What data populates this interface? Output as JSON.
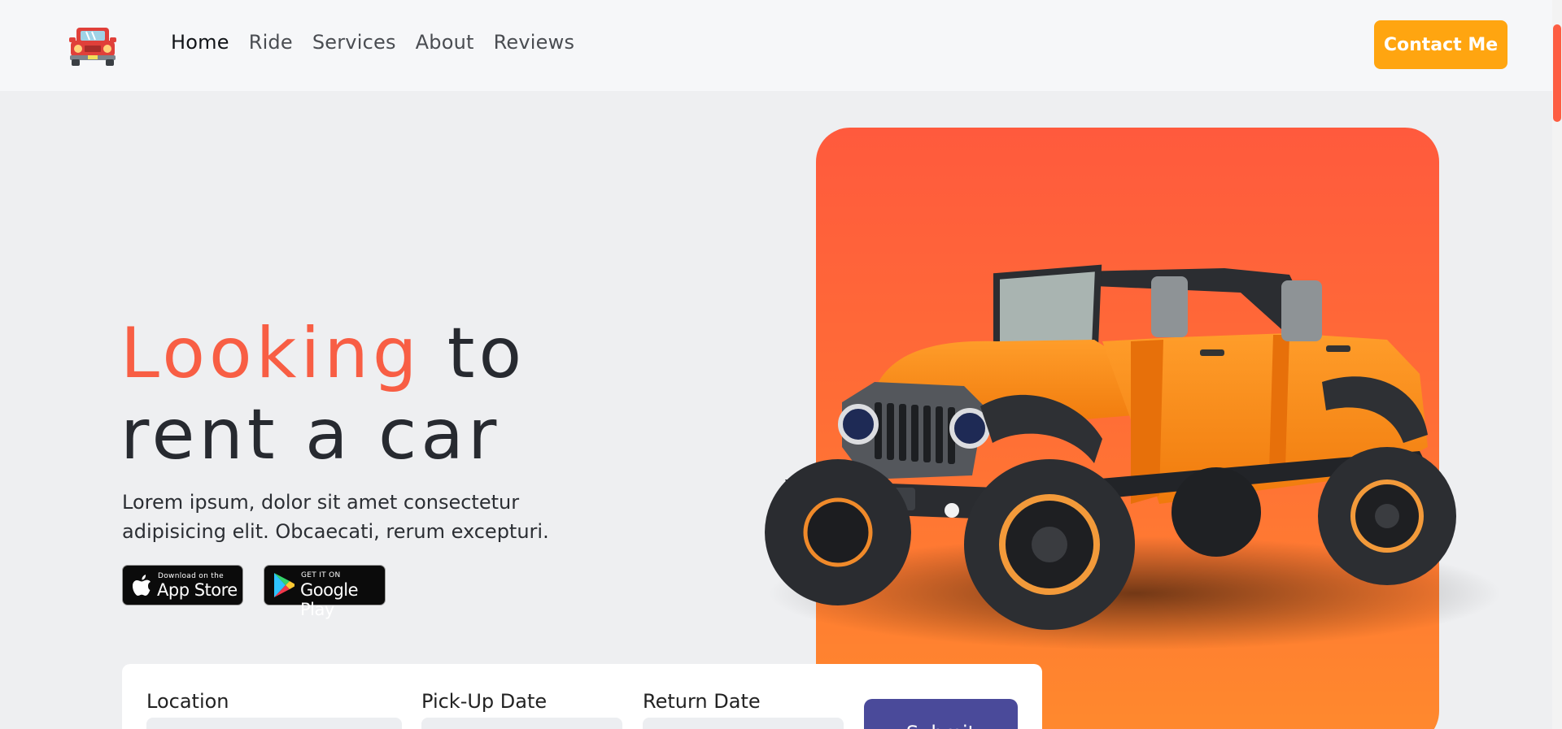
{
  "nav": {
    "logo": "jeep-logo-icon",
    "links": [
      "Home",
      "Ride",
      "Services",
      "About",
      "Reviews"
    ],
    "active": "Home",
    "contact_label": "Contact Me"
  },
  "hero": {
    "title_accent": "Looking",
    "title_rest_line1": "to",
    "title_line2": "rent a car",
    "description": "Lorem ipsum, dolor sit amet consectetur adipisicing elit. Obcaecati, rerum excepturi.",
    "image": "orange-jeep-image"
  },
  "badges": {
    "app_store": {
      "small": "Download on the",
      "big": "App Store",
      "icon": "apple-icon"
    },
    "google_play": {
      "small": "GET IT ON",
      "big": "Google Play",
      "icon": "play-store-icon"
    }
  },
  "booking": {
    "location_label": "Location",
    "pickup_label": "Pick-Up Date",
    "return_label": "Return Date",
    "submit_label": "Submit"
  },
  "colors": {
    "accent": "#f85e44",
    "contact": "#ffa510",
    "submit": "#4a4a9a",
    "panel": "#ff6d36"
  }
}
